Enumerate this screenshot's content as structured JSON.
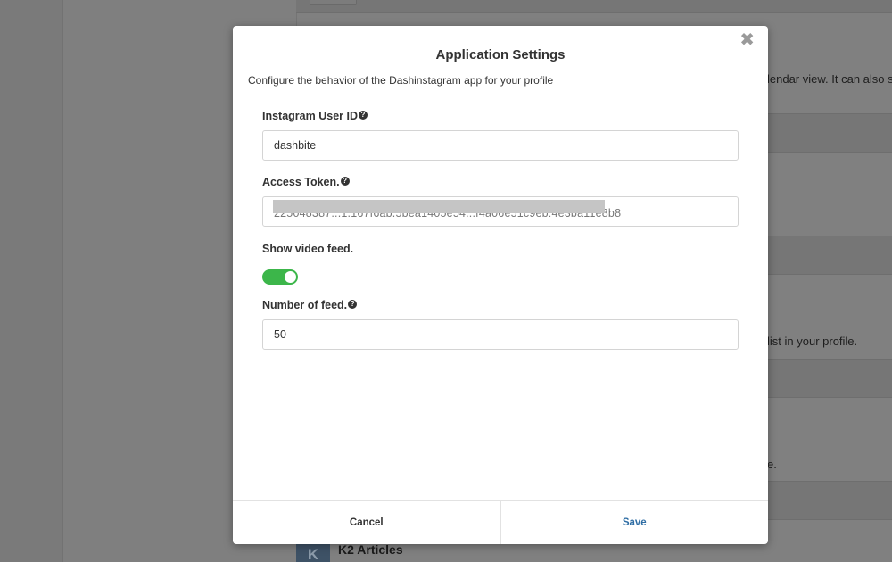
{
  "background": {
    "text_lines": [
      "lendar view. It can also s",
      "list in your profile.",
      "e."
    ],
    "k2": {
      "avatar_letter": "K",
      "title": "K2 Articles"
    }
  },
  "modal": {
    "title": "Application Settings",
    "description": "Configure the behavior of the Dashinstagram app for your profile",
    "close_glyph": "✖",
    "help_glyph": "?",
    "fields": {
      "user_id": {
        "label": "Instagram User ID",
        "value": "dashbite"
      },
      "access_token": {
        "label": "Access Token.",
        "value": "225048387...1.167f6ab.5bea1405e54...f4a06e51c9eb:4e3ba11e8b8"
      },
      "video_feed": {
        "label": "Show video feed.",
        "enabled": true
      },
      "feed_count": {
        "label": "Number of feed.",
        "value": "50"
      }
    },
    "footer": {
      "cancel_label": "Cancel",
      "save_label": "Save"
    }
  },
  "colors": {
    "toggle_on": "#3cb64a",
    "save_link": "#2e6da4",
    "overlay": "#808080"
  }
}
